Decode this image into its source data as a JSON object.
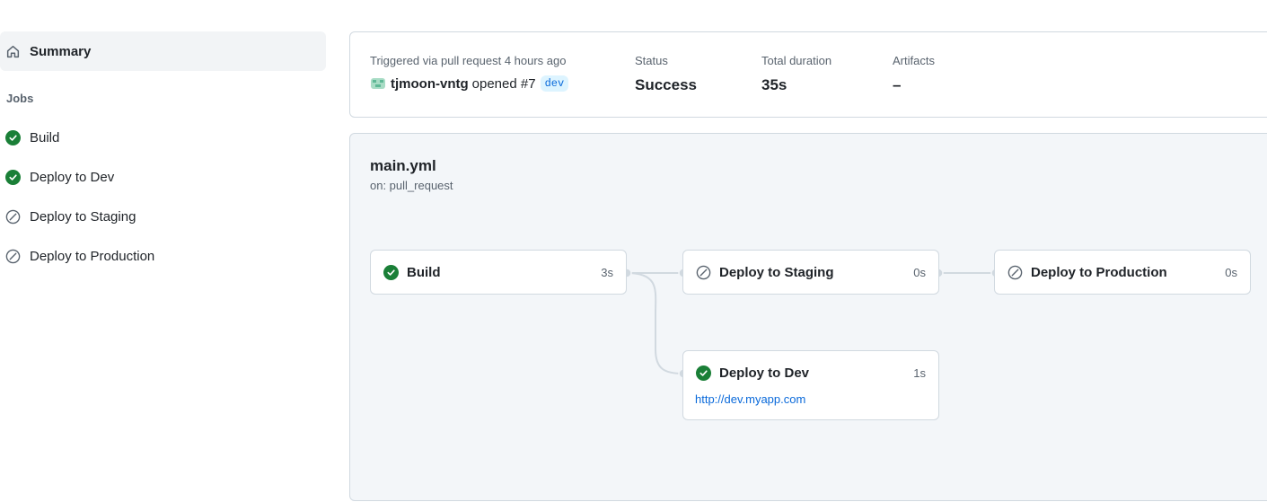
{
  "sidebar": {
    "summary_label": "Summary",
    "jobs_heading": "Jobs",
    "jobs": [
      {
        "label": "Build",
        "status": "success"
      },
      {
        "label": "Deploy to Dev",
        "status": "success"
      },
      {
        "label": "Deploy to Staging",
        "status": "skipped"
      },
      {
        "label": "Deploy to Production",
        "status": "skipped"
      }
    ]
  },
  "run_summary": {
    "trigger_text": "Triggered via pull request 4 hours ago",
    "actor": "tjmoon-vntg",
    "action_text": "opened #7",
    "branch": "dev",
    "status_label": "Status",
    "status_value": "Success",
    "duration_label": "Total duration",
    "duration_value": "35s",
    "artifacts_label": "Artifacts",
    "artifacts_value": "–"
  },
  "workflow": {
    "file_name": "main.yml",
    "trigger": "on: pull_request",
    "jobs": {
      "build": {
        "name": "Build",
        "duration": "3s",
        "status": "success"
      },
      "staging": {
        "name": "Deploy to Staging",
        "duration": "0s",
        "status": "skipped"
      },
      "production": {
        "name": "Deploy to Production",
        "duration": "0s",
        "status": "skipped"
      },
      "dev": {
        "name": "Deploy to Dev",
        "duration": "1s",
        "status": "success",
        "environment_url": "http://dev.myapp.com"
      }
    }
  },
  "colors": {
    "success": "#1a7f37",
    "skipped": "#59636e",
    "link": "#0969da",
    "graph_bg": "#f3f6f9"
  },
  "icons": {
    "summary": "home-icon",
    "success": "check-circle-icon",
    "skipped": "skip-icon"
  }
}
